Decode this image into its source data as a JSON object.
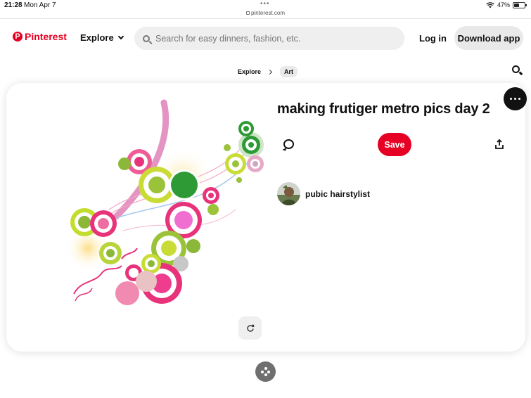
{
  "status_bar": {
    "time": "21:28",
    "date": "Mon Apr 7",
    "url": "pinterest.com",
    "battery": "47%",
    "battery_level": 0.47
  },
  "header": {
    "logo_text": "Pinterest",
    "explore_label": "Explore",
    "search_placeholder": "Search for easy dinners, fashion, etc.",
    "login_label": "Log in",
    "download_label": "Download app"
  },
  "breadcrumb": {
    "items": [
      "Explore",
      "Art"
    ]
  },
  "pin": {
    "title": "making frutiger metro pics day 2",
    "save_label": "Save",
    "author": "pubic hairstylist"
  },
  "colors": {
    "brand": "#e60023",
    "pink": "#e8337a",
    "lime": "#9ac33a",
    "green": "#2e9a35"
  },
  "icons": [
    "search-icon",
    "chevron-down-icon",
    "chevron-right-icon",
    "comment-icon",
    "share-icon",
    "more-icon",
    "rotate-icon",
    "shapes-icon",
    "wifi-icon",
    "battery-icon",
    "lock-icon"
  ]
}
